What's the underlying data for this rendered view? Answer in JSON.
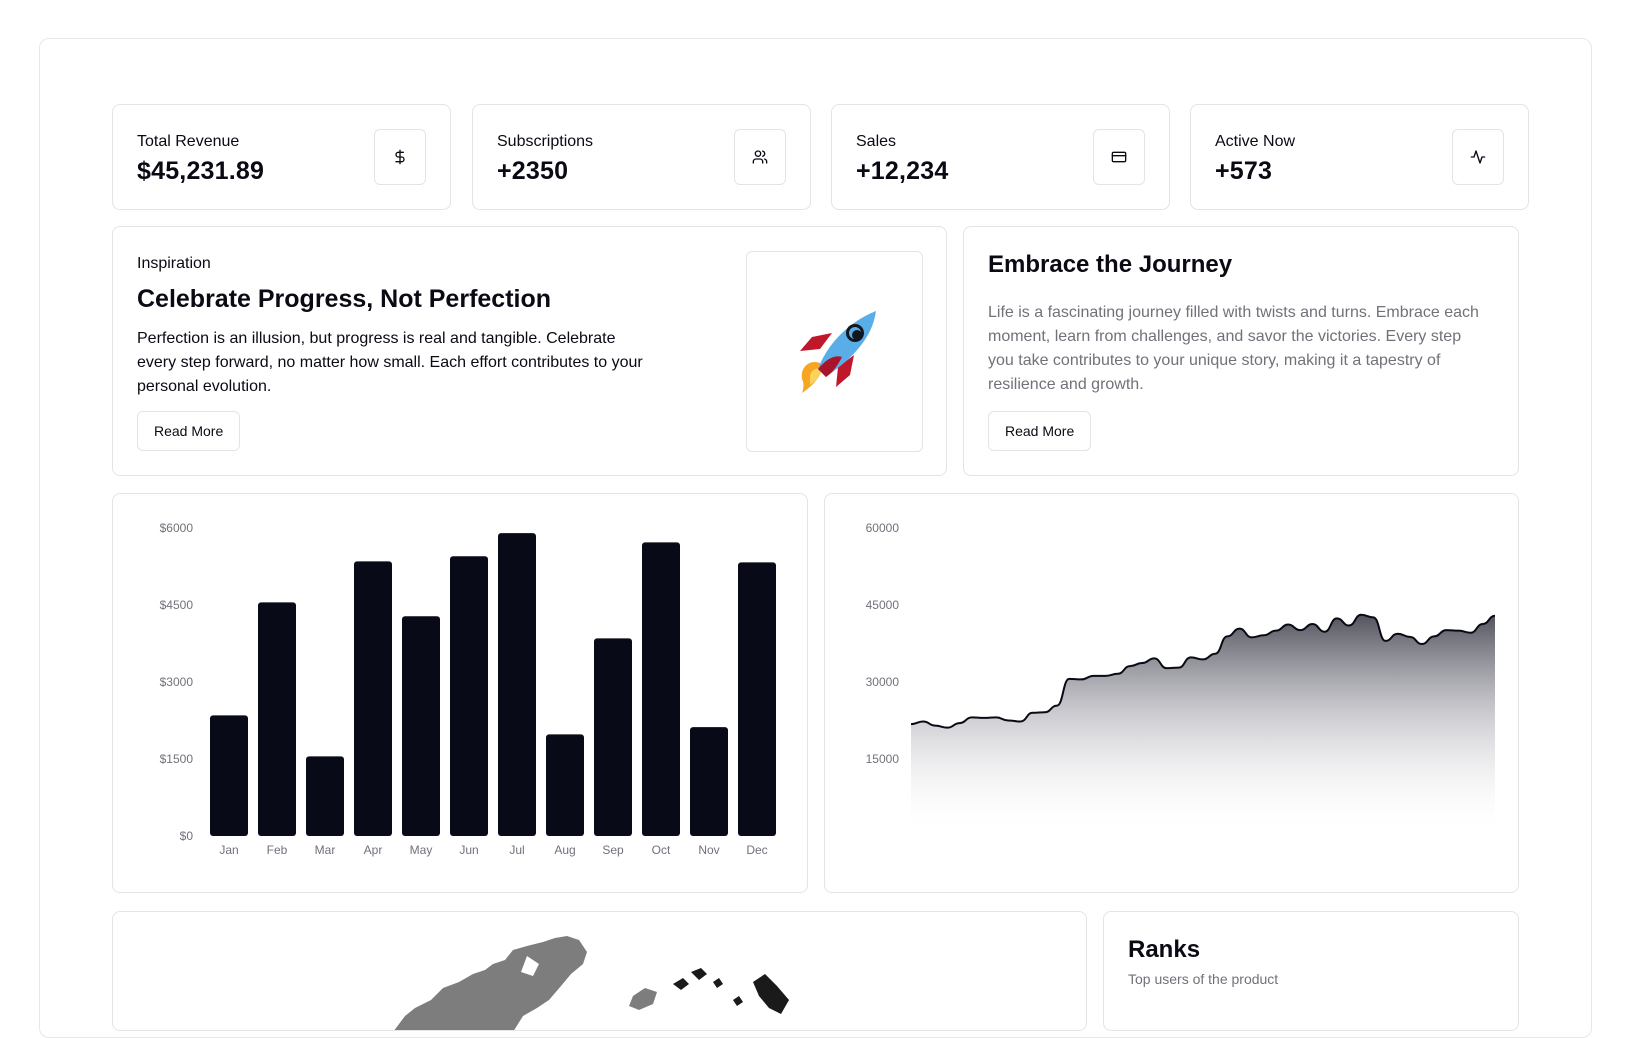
{
  "stats": [
    {
      "label": "Total Revenue",
      "value": "$45,231.89",
      "icon": "dollar-icon"
    },
    {
      "label": "Subscriptions",
      "value": "+2350",
      "icon": "users-icon"
    },
    {
      "label": "Sales",
      "value": "+12,234",
      "icon": "credit-card-icon"
    },
    {
      "label": "Active Now",
      "value": "+573",
      "icon": "activity-icon"
    }
  ],
  "inspiration": {
    "eyebrow": "Inspiration",
    "title": "Celebrate Progress, Not Perfection",
    "body": "Perfection is an illusion, but progress is real and tangible. Celebrate every step forward, no matter how small. Each effort contributes to your personal evolution.",
    "button": "Read More",
    "image": "rocket-icon"
  },
  "journey": {
    "title": "Embrace the Journey",
    "body": "Life is a fascinating journey filled with twists and turns. Embrace each moment, learn from challenges, and savor the victories. Every step you take contributes to your unique story, making it a tapestry of resilience and growth.",
    "button": "Read More"
  },
  "ranks": {
    "title": "Ranks",
    "subtitle": "Top users of the product"
  },
  "colors": {
    "bar": "#080a17",
    "border": "#e4e4e7",
    "muted": "#71717a"
  },
  "chart_data": [
    {
      "type": "bar",
      "categories": [
        "Jan",
        "Feb",
        "Mar",
        "Apr",
        "May",
        "Jun",
        "Jul",
        "Aug",
        "Sep",
        "Oct",
        "Nov",
        "Dec"
      ],
      "values": [
        2350,
        4550,
        1550,
        5350,
        4280,
        5450,
        5900,
        1980,
        3850,
        5720,
        2120,
        5330
      ],
      "yticks": [
        "$0",
        "$1500",
        "$3000",
        "$4500",
        "$6000"
      ],
      "ylim": [
        0,
        6000
      ],
      "grid": false
    },
    {
      "type": "area",
      "yticks": [
        "15000",
        "30000",
        "45000",
        "60000"
      ],
      "ylim": [
        0,
        60000
      ],
      "values": [
        21800,
        22300,
        21500,
        21100,
        22000,
        23100,
        23000,
        23100,
        22500,
        22300,
        24000,
        24100,
        25400,
        30600,
        30500,
        31200,
        31200,
        31600,
        33100,
        33700,
        34600,
        32700,
        32800,
        34800,
        34400,
        35500,
        38900,
        40400,
        38700,
        39100,
        40000,
        41200,
        40100,
        41300,
        39800,
        42400,
        41000,
        43100,
        42600,
        38000,
        39400,
        38800,
        37400,
        38900,
        40100,
        40000,
        39600,
        41300,
        42900
      ],
      "grid": false
    }
  ]
}
